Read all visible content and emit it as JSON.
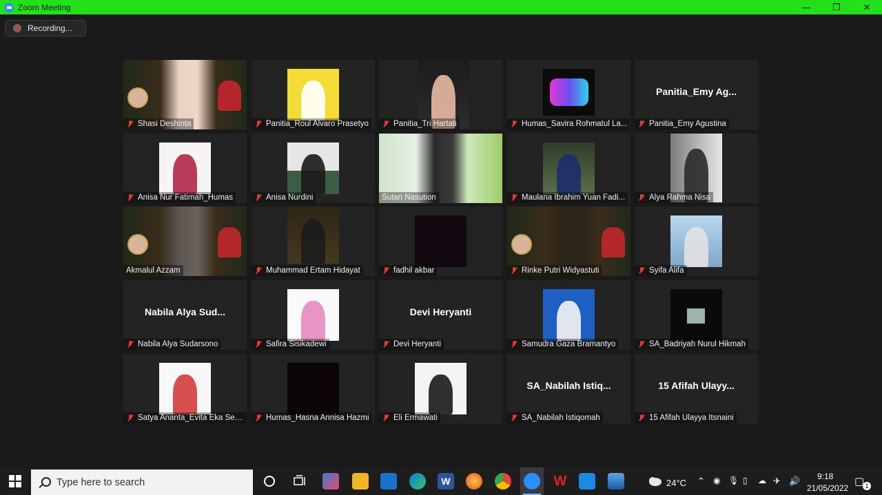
{
  "window": {
    "title": "Zoom Meeting",
    "minimize_icon": "minimize-icon",
    "restore_icon": "restore-icon",
    "close_icon": "close-icon"
  },
  "recording": {
    "label": "Recording..."
  },
  "participants": [
    {
      "name": "Shasi Deshinta",
      "muted": true
    },
    {
      "name": "Panitia_Roul Alvaro Prasetyo",
      "muted": true
    },
    {
      "name": "Panitia_Tri Hartati",
      "muted": true
    },
    {
      "name": "Humas_Savira Rohmatul La...",
      "muted": true
    },
    {
      "name": "Panitia_Emy Agustina",
      "display": "Panitia_Emy  Ag...",
      "muted": true
    },
    {
      "name": "Anisa Nur Fatimah_Humas",
      "muted": true
    },
    {
      "name": "Anisa Nurdini",
      "muted": true
    },
    {
      "name": "Sutan  Nasution",
      "muted": false
    },
    {
      "name": "Maulana Ibrahim Yuan Fadi...",
      "muted": true
    },
    {
      "name": "Alya Rahma Nisa",
      "muted": true
    },
    {
      "name": "Akmalul Azzam",
      "muted": false,
      "active_speaker": true
    },
    {
      "name": "Muhammad Ertam Hidayat",
      "muted": true
    },
    {
      "name": "fadhil akbar",
      "muted": true
    },
    {
      "name": "Rinke Putri Widyastuti",
      "muted": true
    },
    {
      "name": "Syifa Alifa",
      "muted": true
    },
    {
      "name": "Nabila Alya Sudarsono",
      "display": "Nabila  Alya  Sud...",
      "muted": true
    },
    {
      "name": "Safira Sisikadewi",
      "muted": true
    },
    {
      "name": "Devi Heryanti",
      "display": "Devi Heryanti",
      "muted": true
    },
    {
      "name": "Samudra Gaza Bramantyo",
      "muted": true
    },
    {
      "name": "SA_Badriyah Nurul Hikmah",
      "muted": true
    },
    {
      "name": "Satya Ananta_Evita Eka Sep...",
      "muted": true
    },
    {
      "name": "Humas_Hasna Annisa Hazmi",
      "muted": true
    },
    {
      "name": "Eli Ermawati",
      "muted": true
    },
    {
      "name": "SA_Nabilah Istiqomah",
      "display": "SA_Nabilah  Istiq...",
      "muted": true
    },
    {
      "name": "15 Afifah Ulayya Itsnaini",
      "display": "15  Afifah  Ulayy...",
      "muted": true
    }
  ],
  "taskbar": {
    "search_placeholder": "Type here to search",
    "weather": "24°C",
    "time": "9:18",
    "date": "21/05/2022",
    "notification_count": "1"
  },
  "colors": {
    "titlebar": "#22e11a",
    "active_speaker_border": "#d7e27a",
    "muted_icon": "#e03a3a"
  }
}
